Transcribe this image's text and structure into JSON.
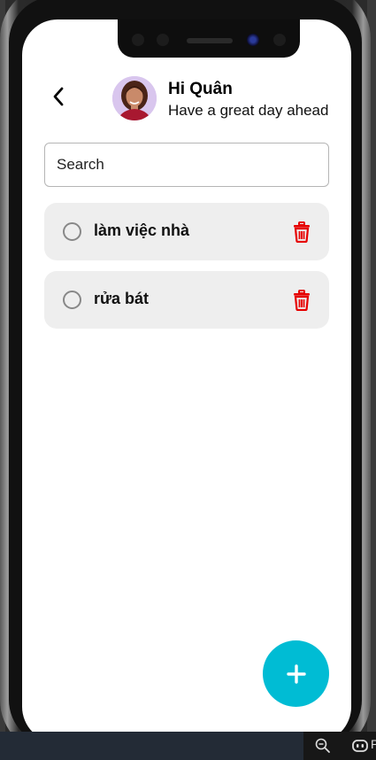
{
  "header": {
    "greeting": "Hi Quân",
    "subtitle": "Have a great day ahead"
  },
  "search": {
    "placeholder": "Search"
  },
  "todos": [
    {
      "label": "làm việc nhà",
      "done": false
    },
    {
      "label": "rửa bát",
      "done": false
    }
  ],
  "colors": {
    "fab": "#00bcd4",
    "delete": "#e60000",
    "card": "#eeeeee"
  },
  "icons": {
    "back": "chevron-left-icon",
    "delete": "trash-icon",
    "add": "plus-icon",
    "zoom": "zoom-out-icon",
    "copilot": "copilot-icon"
  },
  "taskbar": {
    "overflow_text": "P"
  }
}
